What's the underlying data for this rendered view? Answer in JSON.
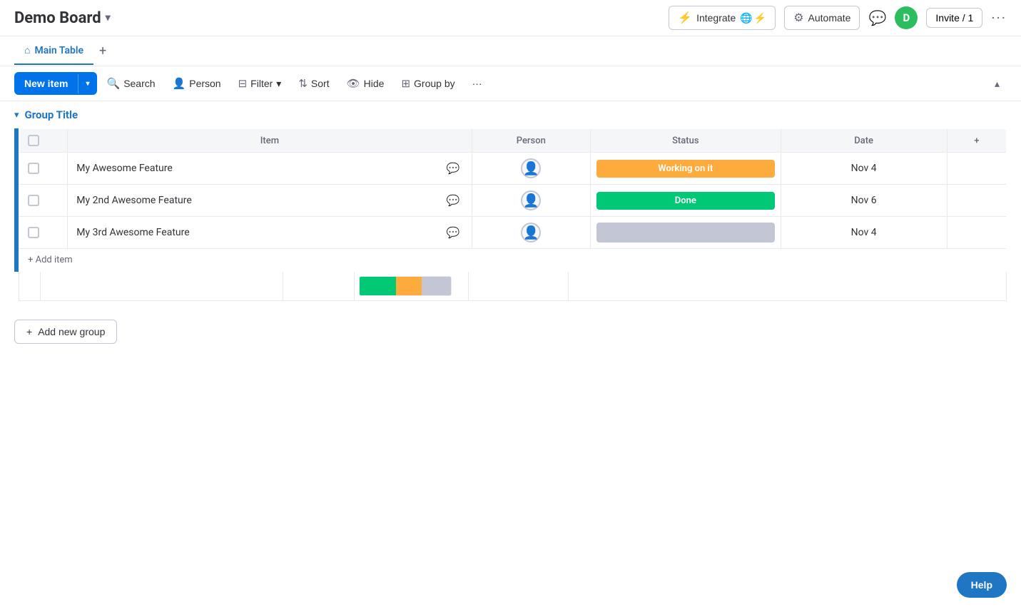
{
  "header": {
    "title": "Demo Board",
    "title_chevron": "▾",
    "integrate_label": "Integrate",
    "automate_label": "Automate",
    "avatar_letter": "D",
    "invite_label": "Invite / 1"
  },
  "tabs": [
    {
      "label": "Main Table",
      "active": true,
      "icon": "home"
    }
  ],
  "toolbar": {
    "new_item_label": "New item",
    "search_label": "Search",
    "person_label": "Person",
    "filter_label": "Filter",
    "sort_label": "Sort",
    "hide_label": "Hide",
    "group_by_label": "Group by"
  },
  "group": {
    "title": "Group Title"
  },
  "table": {
    "columns": [
      "Item",
      "Person",
      "Status",
      "Date"
    ],
    "rows": [
      {
        "name": "My Awesome Feature",
        "person": "",
        "status": "Working on it",
        "status_type": "working",
        "date": "Nov 4"
      },
      {
        "name": "My 2nd Awesome Feature",
        "person": "",
        "status": "Done",
        "status_type": "done",
        "date": "Nov 6"
      },
      {
        "name": "My 3rd Awesome Feature",
        "person": "",
        "status": "",
        "status_type": "empty",
        "date": "Nov 4"
      }
    ],
    "add_item_label": "+ Add item"
  },
  "add_group": {
    "label": "Add new group"
  },
  "help": {
    "label": "Help"
  }
}
